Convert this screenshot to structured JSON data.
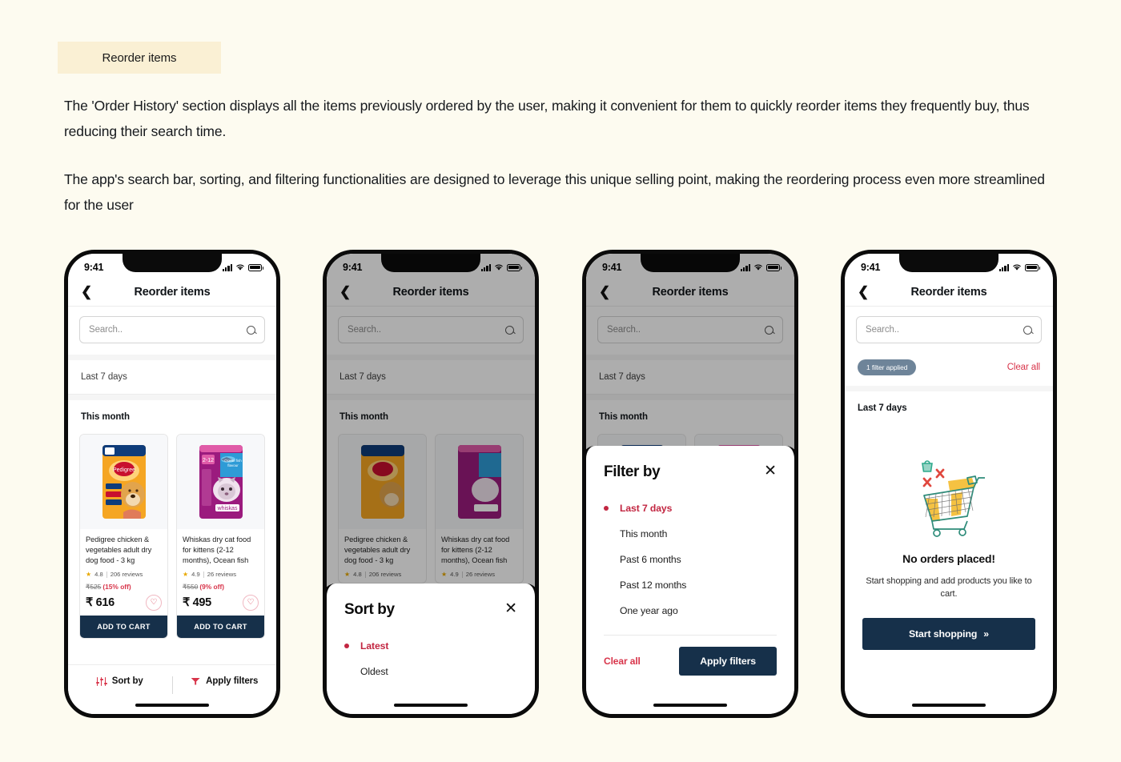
{
  "page": {
    "tag_label": "Reorder items",
    "paragraph_1": "The 'Order History' section displays all the items previously ordered by the user, making it convenient for them to quickly reorder items they frequently buy, thus reducing their search time.",
    "paragraph_2": "The app's search bar, sorting, and filtering functionalities are designed to leverage this unique selling point, making the reordering process even more streamlined for the user",
    "background_color": "#FDFBF0",
    "tag_background_color": "#FAF0D4"
  },
  "status_bar": {
    "time": "9:41"
  },
  "app_bar": {
    "title": "Reorder items",
    "back_icon": "chevron-left-icon"
  },
  "search": {
    "placeholder": "Search..",
    "value": "",
    "icon": "search-icon"
  },
  "sections": {
    "last_7_days": "Last 7 days",
    "this_month": "This month"
  },
  "products": [
    {
      "title": "Pedigree chicken & vegetables adult dry dog food - 3 kg",
      "rating": "4.8",
      "reviews": "206 reviews",
      "mrp": "₹525",
      "discount": "(15% off)",
      "price": "₹ 616",
      "cta": "ADD TO CART",
      "wishlist_icon": "heart-icon",
      "image": "pedigree-dog-food-pack"
    },
    {
      "title": "Whiskas dry cat food for kittens (2-12 months), Ocean fish fl...",
      "rating": "4.9",
      "reviews": "26 reviews",
      "mrp": "₹550",
      "discount": "(9% off)",
      "price": "₹ 495",
      "cta": "ADD TO CART",
      "wishlist_icon": "heart-icon",
      "image": "whiskas-cat-food-pack"
    }
  ],
  "bottom_bar": {
    "sort_label": "Sort by",
    "sort_icon": "sort-sliders-icon",
    "filter_label": "Apply filters",
    "filter_icon": "funnel-icon"
  },
  "sort_sheet": {
    "title": "Sort by",
    "close_icon": "close-icon",
    "options": [
      {
        "label": "Latest",
        "selected": true
      },
      {
        "label": "Oldest",
        "selected": false
      }
    ]
  },
  "filter_sheet": {
    "title": "Filter by",
    "close_icon": "close-icon",
    "options": [
      {
        "label": "Last 7 days",
        "selected": true
      },
      {
        "label": "This month",
        "selected": false
      },
      {
        "label": "Past 6 months",
        "selected": false
      },
      {
        "label": "Past 12 months",
        "selected": false
      },
      {
        "label": "One year ago",
        "selected": false
      }
    ],
    "clear_all": "Clear all",
    "apply": "Apply filters"
  },
  "filtered_screen": {
    "chip_label": "1 filter applied",
    "clear_all": "Clear all",
    "section_label": "Last 7 days",
    "illustration": "empty-shopping-cart-illustration",
    "empty_title": "No orders placed!",
    "empty_subtitle": "Start shopping and add products you like to cart.",
    "cta_label": "Start shopping",
    "cta_icon": "double-chevron-right-icon"
  },
  "colors": {
    "navy": "#16304A",
    "red": "#D8344A",
    "crimson": "#C22641",
    "chip_slate": "#6E8499",
    "star_gold": "#E8A800"
  }
}
